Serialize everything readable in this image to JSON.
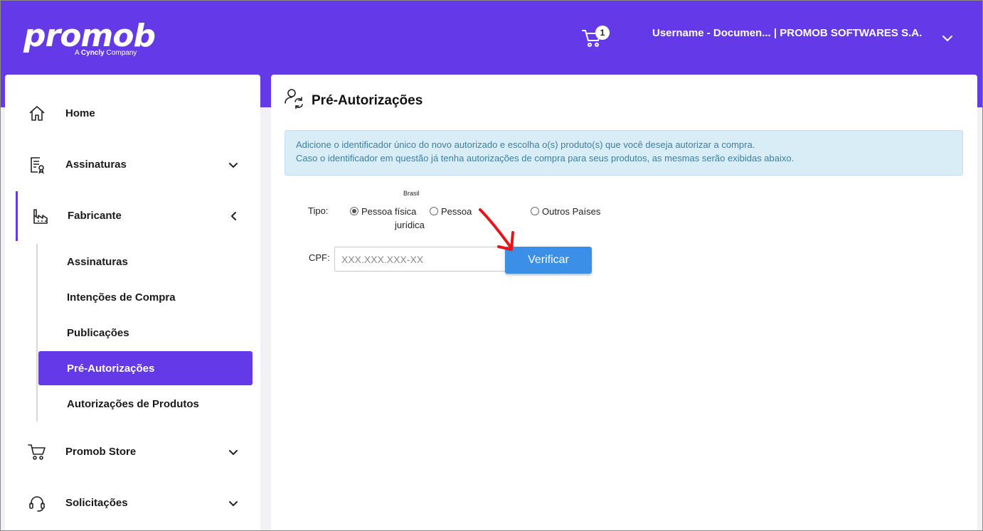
{
  "header": {
    "logo_word": "promob",
    "logo_sub_prefix": "A ",
    "logo_sub_brand": "Cyncly",
    "logo_sub_suffix": " Company",
    "cart_count": "1",
    "user_label": "Username - Documen... | PROMOB SOFTWARES S.A."
  },
  "sidebar": {
    "items": [
      {
        "label": "Home"
      },
      {
        "label": "Assinaturas"
      },
      {
        "label": "Fabricante"
      },
      {
        "label": "Promob Store"
      },
      {
        "label": "Solicitações"
      }
    ],
    "fabricante_sub": [
      {
        "label": "Assinaturas"
      },
      {
        "label": "Intenções de Compra"
      },
      {
        "label": "Publicações"
      },
      {
        "label": "Pré-Autorizações"
      },
      {
        "label": "Autorizações de Produtos"
      }
    ]
  },
  "main": {
    "title": "Pré-Autorizações",
    "info_line1": "Adicione o identificador único do novo autorizado e escolha o(s) produto(s) que você deseja autorizar a compra.",
    "info_line2": "Caso o identificador em questão já tenha autorizações de compra para seus produtos, as mesmas serão exibidas abaixo.",
    "form": {
      "tipo_label": "Tipo:",
      "brasil_label": "Brasil",
      "option_pf": "Pessoa física",
      "option_pj_line1": "Pessoa",
      "option_pj_line2": "jurídica",
      "option_outros": "Outros Países",
      "selected": "Pessoa física",
      "cpf_label": "CPF:",
      "cpf_placeholder": "XXX.XXX.XXX-XX",
      "cpf_value": "",
      "verify_label": "Verificar"
    }
  },
  "colors": {
    "brand": "#6439e8",
    "button": "#3b8fe6",
    "info_bg": "#d9edf6",
    "info_text": "#3d7fa3",
    "annotation_arrow": "#e8141c"
  }
}
